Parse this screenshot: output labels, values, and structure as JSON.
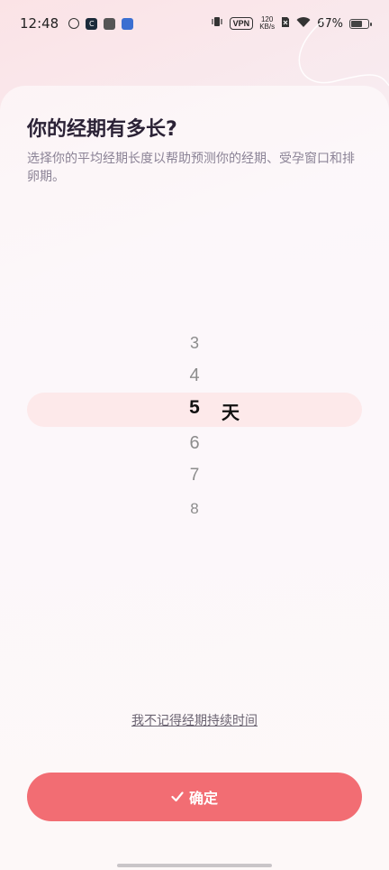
{
  "status_bar": {
    "time": "12:48",
    "vpn": "VPN",
    "net_speed_value": "120",
    "net_speed_unit": "KB/s",
    "battery_percent": 67,
    "battery_text": "67%"
  },
  "header": {
    "title": "你的经期有多长?",
    "subtitle": "选择你的平均经期长度以帮助预测你的经期、受孕窗口和排卵期。"
  },
  "picker": {
    "items": [
      "3",
      "4",
      "5",
      "6",
      "7",
      "8"
    ],
    "selected": "5",
    "unit": "天"
  },
  "forget_link": "我不记得经期持续时间",
  "confirm_button": {
    "label": "确定",
    "color": "#f26d73"
  },
  "colors": {
    "highlight": "#fde9ea"
  }
}
